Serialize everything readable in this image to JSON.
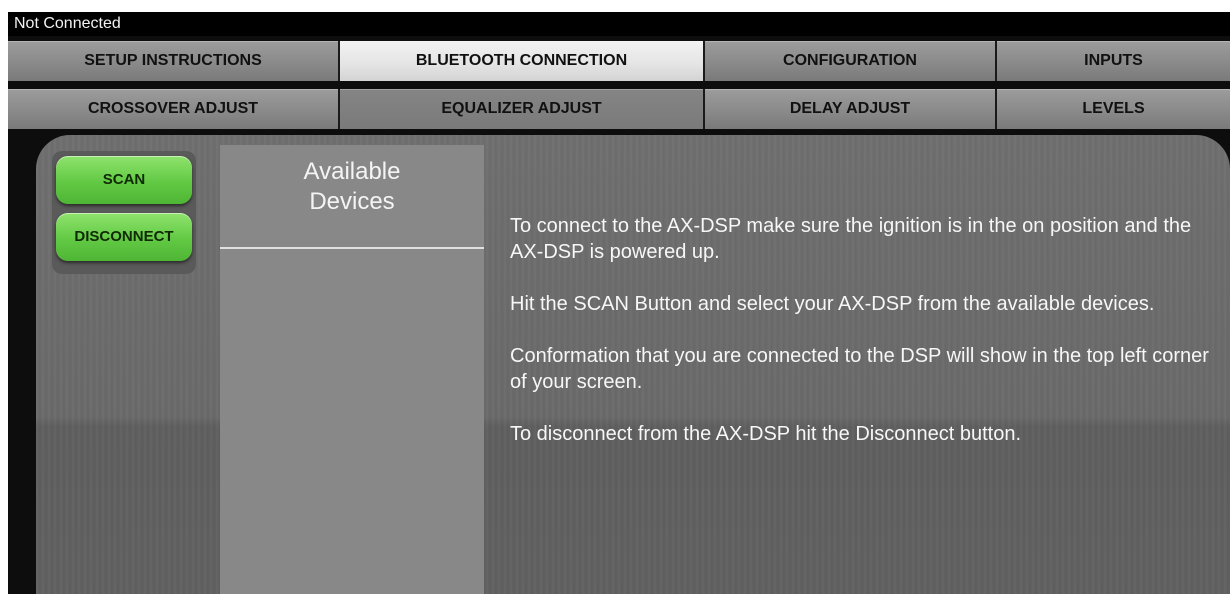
{
  "status": {
    "text": "Not Connected"
  },
  "tabs_row1": [
    {
      "label": "SETUP INSTRUCTIONS"
    },
    {
      "label": "BLUETOOTH CONNECTION"
    },
    {
      "label": "CONFIGURATION"
    },
    {
      "label": "INPUTS"
    }
  ],
  "tabs_row2": [
    {
      "label": "CROSSOVER ADJUST"
    },
    {
      "label": "EQUALIZER ADJUST"
    },
    {
      "label": "DELAY ADJUST"
    },
    {
      "label": "LEVELS"
    }
  ],
  "buttons": {
    "scan": "SCAN",
    "disconnect": "DISCONNECT"
  },
  "devices": {
    "title_line1": "Available",
    "title_line2": "Devices"
  },
  "instructions": [
    "To connect to the AX-DSP make sure the ignition is in the on position and the AX-DSP is powered up.",
    "Hit the SCAN Button and select your AX-DSP from the available devices.",
    "Conformation that you are connected to the DSP will show in the top left corner of your screen.",
    "To disconnect from the AX-DSP hit the Disconnect button."
  ],
  "colors": {
    "button_green": "#62c944",
    "active_tab": "#e4e4e4",
    "tab": "#8a8a8a",
    "panel": "#6a6a6a"
  }
}
